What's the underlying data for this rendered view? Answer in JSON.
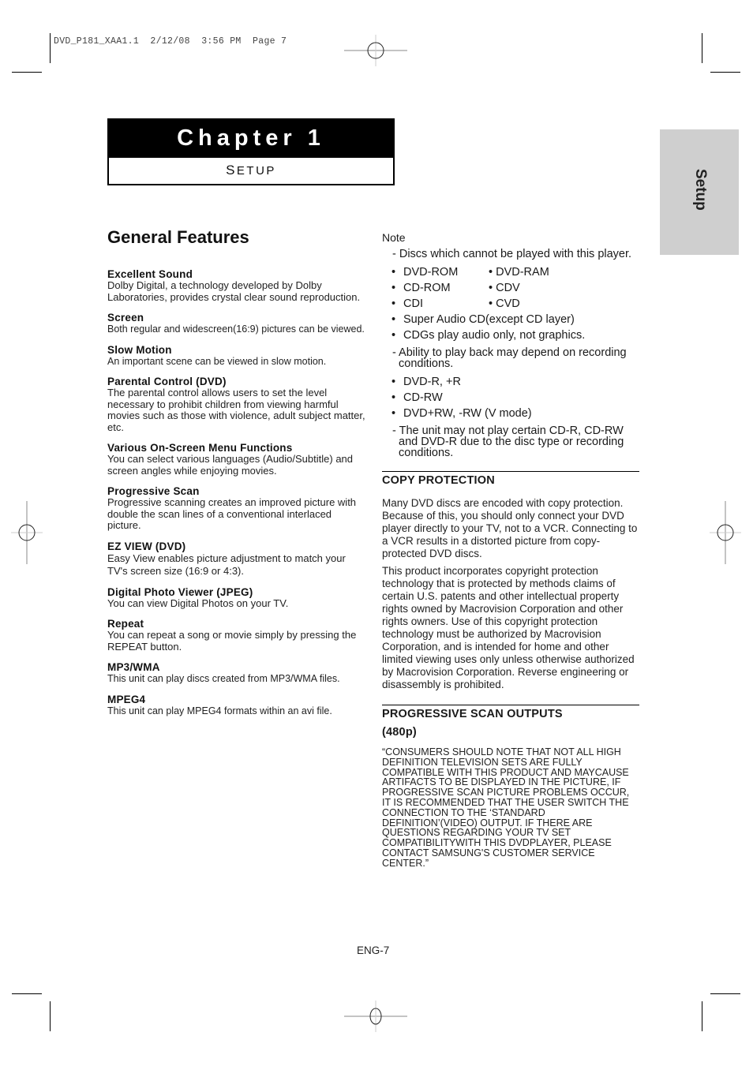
{
  "print_slug": "DVD_P181_XAA1.1  2/12/08  3:56 PM  Page 7",
  "chapter": {
    "title": "Chapter 1",
    "subtitle_initial": "S",
    "subtitle_rest": "ETUP"
  },
  "side_tab": {
    "label": "Setup",
    "color": "#cfcfcf"
  },
  "general_features": {
    "heading": "General Features",
    "items": [
      {
        "title": "Excellent Sound",
        "desc": "Dolby Digital, a technology developed by Dolby Laboratories, provides crystal clear sound reproduction."
      },
      {
        "title": "Screen",
        "desc": "Both regular and widescreen(16:9) pictures can be viewed."
      },
      {
        "title": "Slow Motion",
        "desc": "An important scene can be viewed in slow motion."
      },
      {
        "title": "Parental Control (DVD)",
        "desc": "The parental control allows users to set the level necessary to prohibit children from viewing harmful movies such as those with violence, adult subject matter, etc."
      },
      {
        "title": "Various On-Screen Menu Functions",
        "desc": "You can select various languages (Audio/Subtitle) and screen angles while enjoying movies."
      },
      {
        "title": "Progressive Scan",
        "desc": "Progressive scanning creates an improved picture with double the scan lines of a conventional interlaced picture."
      },
      {
        "title": "EZ VIEW (DVD)",
        "desc": "Easy View enables picture adjustment to match your TV's screen size (16:9 or 4:3)."
      },
      {
        "title": "Digital Photo Viewer (JPEG)",
        "desc": "You can view Digital Photos on your TV."
      },
      {
        "title": "Repeat",
        "desc": "You can repeat a song or movie simply by pressing the REPEAT button."
      },
      {
        "title": "MP3/WMA",
        "desc": "This unit can play discs created from MP3/WMA files."
      },
      {
        "title": "MPEG4",
        "desc": "This unit can play MPEG4 formats within an avi file."
      }
    ]
  },
  "note": {
    "label": "Note",
    "unplayable_intro": "- Discs which cannot be played with this player.",
    "unplayable_pairs": [
      [
        "DVD-ROM",
        "DVD-RAM"
      ],
      [
        "CD-ROM",
        "CDV"
      ],
      [
        "CDI",
        "CVD"
      ]
    ],
    "unplayable_single": [
      "Super Audio CD(except CD layer)",
      "CDGs play audio only, not graphics."
    ],
    "ability_intro": "- Ability to play back may depend on recording conditions.",
    "ability_items": [
      "DVD-R, +R",
      "CD-RW",
      "DVD+RW, -RW (V mode)"
    ],
    "unit_may_not": "- The unit may not play certain CD-R, CD-RW and DVD-R due to the disc type or recording conditions."
  },
  "copy_protection": {
    "heading": "COPY PROTECTION",
    "para1": "Many DVD discs are encoded with copy protection. Because of this, you should only connect your DVD player directly to your TV, not to a VCR. Connecting to a VCR results in a distorted picture from copy-protected DVD discs.",
    "para2": "This product incorporates copyright protection technology that is protected by methods claims of certain U.S. patents and other intellectual property rights owned by Macrovision Corporation and other rights owners. Use of this copyright protection technology must be authorized by Macrovision Corporation, and is intended for home and other limited viewing uses only unless otherwise authorized by Macrovision Corporation. Reverse engineering or disassembly is prohibited."
  },
  "progressive_scan": {
    "heading_line1": "PROGRESSIVE SCAN OUTPUTS",
    "heading_line2": "(480p)",
    "text": "“CONSUMERS SHOULD NOTE THAT NOT ALL HIGH DEFINITION TELEVISION SETS ARE FULLY COMPATIBLE WITH THIS PRODUCT AND MAYCAUSE ARTIFACTS TO BE DISPLAYED IN THE PICTURE, IF PROGRESSIVE SCAN PICTURE PROBLEMS OCCUR, IT IS RECOMMENDED THAT THE USER SWITCH THE CONNECTION TO THE ‘STANDARD DEFINITION’(VIDEO) OUTPUT. IF THERE ARE QUESTIONS REGARDING YOUR TV SET COMPATIBILITYWITH THIS DVDPLAYER, PLEASE CONTACT SAMSUNG'S CUSTOMER SERVICE CENTER.”"
  },
  "page_number": "ENG-7"
}
